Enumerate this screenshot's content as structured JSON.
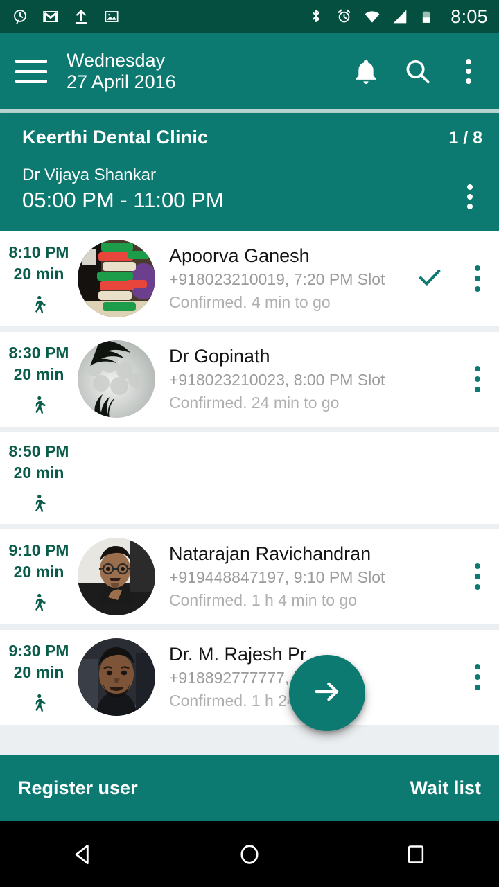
{
  "theme": {
    "primary": "#0d7a72",
    "status_bar": "#044f40",
    "accent_dark_green": "#0b5c4a",
    "list_bg": "#eceff1",
    "muted_text": "#9b9b9b"
  },
  "status_bar": {
    "left_icons": [
      "clock-history-icon",
      "gmail-icon",
      "upload-icon",
      "screenshot-image-icon"
    ],
    "right_icons": [
      "bluetooth-icon",
      "alarm-icon",
      "wifi-icon",
      "cell-signal-icon",
      "battery-icon"
    ],
    "clock": "8:05"
  },
  "toolbar": {
    "menu_icon": "hamburger-menu-icon",
    "day": "Wednesday",
    "date": "27 April 2016",
    "actions": [
      "notifications-bell-icon",
      "search-icon",
      "overflow-menu-icon"
    ]
  },
  "clinic": {
    "name": "Keerthi Dental Clinic",
    "count": "1 / 8",
    "doctor": "Dr Vijaya Shankar",
    "hours": "05:00 PM - 11:00 PM",
    "overflow_icon": "overflow-menu-icon"
  },
  "appointments": [
    {
      "time": "8:10 PM",
      "duration": "20 min",
      "walk_icon": "walking-person-icon",
      "name": "Apoorva Ganesh",
      "phone_slot": "+918023210019, 7:20 PM Slot",
      "status": "Confirmed. 4 min to go",
      "checked": true,
      "avatar": "blocks-photo",
      "empty": false
    },
    {
      "time": "8:30 PM",
      "duration": "20 min",
      "walk_icon": "walking-person-icon",
      "name": "Dr Gopinath",
      "phone_slot": "+918023210023, 8:00 PM Slot",
      "status": "Confirmed. 24 min to go",
      "checked": false,
      "avatar": "clouds-palm-photo",
      "empty": false
    },
    {
      "time": "8:50 PM",
      "duration": "20 min",
      "walk_icon": "walking-person-icon",
      "name": "",
      "phone_slot": "",
      "status": "",
      "checked": false,
      "avatar": "",
      "empty": true
    },
    {
      "time": "9:10 PM",
      "duration": "20 min",
      "walk_icon": "walking-person-icon",
      "name": "Natarajan Ravichandran",
      "phone_slot": "+919448847197, 9:10 PM Slot",
      "status": "Confirmed. 1 h 4 min to go",
      "checked": false,
      "avatar": "man-glasses-photo",
      "empty": false
    },
    {
      "time": "9:30 PM",
      "duration": "20 min",
      "walk_icon": "walking-person-icon",
      "name": "Dr. M. Rajesh Pr",
      "phone_slot": "+918892777777,            lot",
      "status": "Confirmed. 1 h 24          go",
      "checked": false,
      "avatar": "man-beard-photo",
      "empty": false
    }
  ],
  "fab": {
    "icon": "arrow-right-icon"
  },
  "bottom_bar": {
    "left_label": "Register user",
    "right_label": "Wait list"
  },
  "nav_bar": {
    "back": "back-triangle-icon",
    "home": "home-circle-icon",
    "recents": "recents-square-icon"
  }
}
